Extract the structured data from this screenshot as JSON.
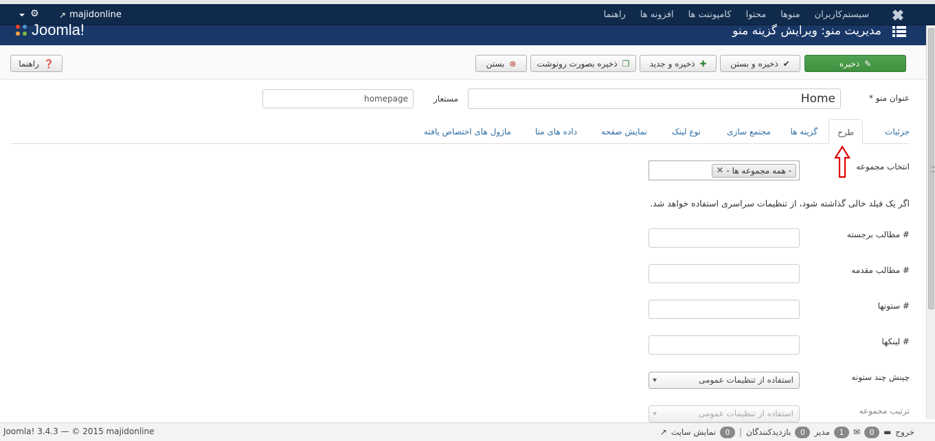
{
  "navbar": {
    "menu": [
      "سیستم",
      "کاربران",
      "منوها",
      "محتوا",
      "کامپوننت ها",
      "افزونه ها",
      "راهنما"
    ],
    "site_name": "majidonline"
  },
  "header": {
    "brand": "Joomla!",
    "page_title": "مدیریت منو: ویرایش گزینه منو"
  },
  "toolbar": {
    "save": "ذخیره",
    "save_close": "ذخیره و بستن",
    "save_new": "ذخیره و جدید",
    "save_copy": "ذخیره بصورت رونوشت",
    "close": "بستن",
    "help": "راهنما"
  },
  "form": {
    "title_label": "عنوان منو *",
    "title_value": "Home",
    "alias_label": "مستعار",
    "alias_value": "homepage"
  },
  "tabs": [
    "جزئیات",
    "طرح",
    "گزینه ها",
    "مجتمع سازی",
    "نوع لینک",
    "نمایش صفحه",
    "داده های متا",
    "ماژول های اختصاص یافته"
  ],
  "layout": {
    "category_label": "انتخاب مجموعه",
    "category_tag": "- همه مجموعه ها -",
    "info": "اگر یک فیلد خالی گذاشته شود، از تنظیمات سراسری استفاده خواهد شد.",
    "fields": [
      {
        "label": "# مطالب برجسته",
        "value": ""
      },
      {
        "label": "# مطالب مقدمه",
        "value": ""
      },
      {
        "label": "# ستونها",
        "value": ""
      },
      {
        "label": "# لینکها",
        "value": ""
      }
    ],
    "multi_column_label": "چینش چند ستونه",
    "multi_column_value": "استفاده از تنظیمات عمومی",
    "category_order_label": "ترتیب مجموعه",
    "category_order_value": "استفاده از تنظیمات عمومی"
  },
  "footer": {
    "view_site": "نمایش سایت",
    "view_site_count": "0",
    "visitors": "بازدیدکنندگان",
    "visitors_count": "0",
    "admin": "مدیر",
    "admin_count": "1",
    "messages_count": "0",
    "logout": "خروج",
    "copyright": "Joomla! 3.4.3 — © 2015 majidonline"
  },
  "colors": {
    "navbar": "#102a4c",
    "header": "#1a3867",
    "save_button": "#46a046",
    "tab_link": "#2e6da4",
    "annotation_arrow": "#e00000"
  }
}
